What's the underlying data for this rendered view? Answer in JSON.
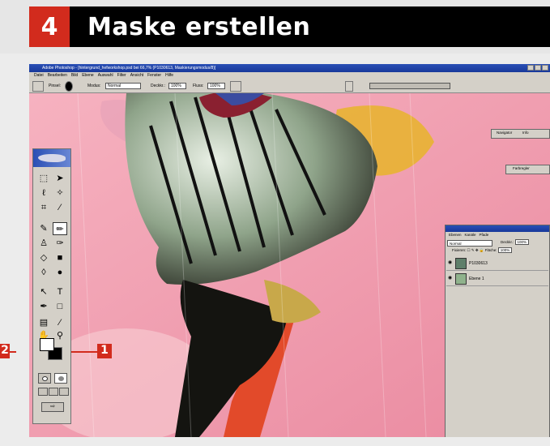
{
  "banner": {
    "step_number": "4",
    "title": "Maske erstellen"
  },
  "photoshop": {
    "window_title": "Adobe Photoshop - [hintergrund_hefworkshop.psd bei 66,7% (P1030613, Maskierungsmodus/8)]",
    "menu": [
      "Datei",
      "Bearbeiten",
      "Bild",
      "Ebene",
      "Auswahl",
      "Filter",
      "Ansicht",
      "Fenster",
      "Hilfe"
    ],
    "options": {
      "brush_label": "Pinsel:",
      "mode_label": "Modus:",
      "mode_value": "Normal",
      "opacity_label": "Deckkr.:",
      "opacity_value": "100%",
      "flow_label": "Fluss:",
      "flow_value": "100%"
    },
    "panels": {
      "navigator_tab": "Navigator",
      "info_tab": "Info",
      "color_tab": "Farbregler"
    },
    "layers_panel": {
      "tabs": [
        "Ebenen",
        "Kanäle",
        "Pfade"
      ],
      "blend_mode": "Normal",
      "opacity_label": "Deckkr.:",
      "opacity_value": "100%",
      "lock_label": "Fixieren:",
      "fill_label": "Fläche:",
      "fill_value": "100%",
      "layers": [
        "P1030613",
        "Ebene 1"
      ]
    },
    "callouts": [
      "1",
      "2"
    ]
  },
  "colors": {
    "accent_red": "#d22b1d",
    "banner_black": "#000000",
    "canvas_pink": "#f0a4b2"
  }
}
